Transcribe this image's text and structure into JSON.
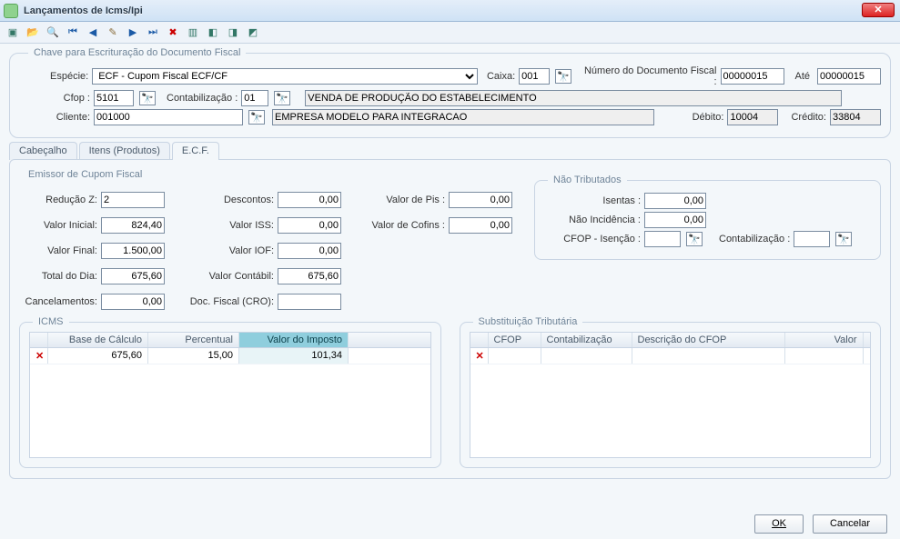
{
  "window": {
    "title": "Lançamentos de Icms/Ipi"
  },
  "toolbar_icons": [
    "new",
    "open",
    "search",
    "nav-first",
    "nav-prev",
    "edit",
    "nav-next",
    "nav-last",
    "delete",
    "doc1",
    "doc2",
    "doc3",
    "doc4"
  ],
  "chave": {
    "legend": "Chave para Escrituração do Documento Fiscal",
    "especie_label": "Espécie:",
    "especie_value": "ECF - Cupom Fiscal ECF/CF",
    "caixa_label": "Caixa:",
    "caixa_value": "001",
    "num_doc_label": "Número do Documento Fiscal :",
    "num_doc_value": "00000015",
    "ate_label": "Até",
    "ate_value": "00000015",
    "cfop_label": "Cfop :",
    "cfop_value": "5101",
    "contab_label": "Contabilização :",
    "contab_value": "01",
    "cfop_desc": "VENDA DE PRODUÇÃO DO ESTABELECIMENTO",
    "cliente_label": "Cliente:",
    "cliente_value": "001000",
    "cliente_desc": "EMPRESA MODELO PARA INTEGRACAO",
    "debito_label": "Débito:",
    "debito_value": "10004",
    "credito_label": "Crédito:",
    "credito_value": "33804"
  },
  "tabs": {
    "cabecalho": "Cabeçalho",
    "itens": "Itens (Produtos)",
    "ecf": "E.C.F."
  },
  "ecf": {
    "emissor_legend": "Emissor de Cupom Fiscal",
    "reducao_z_label": "Redução Z:",
    "reducao_z_value": "2",
    "valor_inicial_label": "Valor Inicial:",
    "valor_inicial_value": "824,40",
    "valor_final_label": "Valor Final:",
    "valor_final_value": "1.500,00",
    "total_dia_label": "Total do Dia:",
    "total_dia_value": "675,60",
    "cancel_label": "Cancelamentos:",
    "cancel_value": "0,00",
    "descontos_label": "Descontos:",
    "descontos_value": "0,00",
    "valor_iss_label": "Valor ISS:",
    "valor_iss_value": "0,00",
    "valor_iof_label": "Valor IOF:",
    "valor_iof_value": "0,00",
    "valor_contabil_label": "Valor Contábil:",
    "valor_contabil_value": "675,60",
    "doc_fiscal_cro_label": "Doc. Fiscal (CRO):",
    "doc_fiscal_cro_value": "",
    "valor_pis_label": "Valor de Pis :",
    "valor_pis_value": "0,00",
    "valor_cofins_label": "Valor de Cofins :",
    "valor_cofins_value": "0,00",
    "nao_trib_legend": "Não Tributados",
    "isentas_label": "Isentas :",
    "isentas_value": "0,00",
    "nao_incid_label": "Não Incidência :",
    "nao_incid_value": "0,00",
    "cfop_isencao_label": "CFOP - Isenção :",
    "cfop_isencao_value": "",
    "contab_nt_label": "Contabilização :",
    "contab_nt_value": "",
    "icms_legend": "ICMS",
    "subst_legend": "Substituição Tributária"
  },
  "icms_grid": {
    "headers": [
      "",
      "Base de Cálculo",
      "Percentual",
      "Valor do Imposto"
    ],
    "row": {
      "base": "675,60",
      "perc": "15,00",
      "valor": "101,34"
    }
  },
  "st_grid": {
    "headers": [
      "",
      "CFOP",
      "Contabilização",
      "Descrição do CFOP",
      "Valor"
    ]
  },
  "buttons": {
    "ok": "OK",
    "cancel": "Cancelar"
  }
}
